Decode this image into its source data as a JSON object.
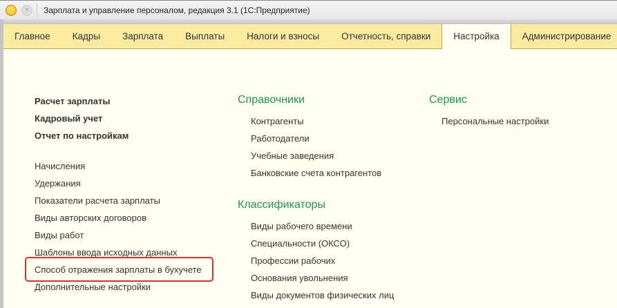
{
  "window": {
    "title": "Зарплата и управление персоналом, редакция 3.1  (1С:Предприятие)",
    "logo_text": "1С"
  },
  "tabs": [
    "Главное",
    "Кадры",
    "Зарплата",
    "Выплаты",
    "Налоги и взносы",
    "Отчетность, справки",
    "Настройка",
    "Администрирование"
  ],
  "active_tab": "Настройка",
  "left": {
    "bold": [
      "Расчет зарплаты",
      "Кадровый учет",
      "Отчет по настройкам"
    ],
    "items": [
      "Начисления",
      "Удержания",
      "Показатели расчета зарплаты",
      "Виды авторских договоров",
      "Виды работ",
      "Шаблоны ввода исходных данных",
      "Способ отражения зарплаты в бухучете",
      "Дополнительные настройки"
    ]
  },
  "middle": {
    "directories_title": "Справочники",
    "directories": [
      "Контрагенты",
      "Работодатели",
      "Учебные заведения",
      "Банковские счета контрагентов"
    ],
    "classifiers_title": "Классификаторы",
    "classifiers": [
      "Виды рабочего времени",
      "Специальности (ОКСО)",
      "Профессии рабочих",
      "Основания увольнения",
      "Виды документов физических лиц"
    ]
  },
  "right": {
    "service_title": "Сервис",
    "service": [
      "Персональные настройки"
    ]
  },
  "colors": {
    "heading": "#1a9a4a",
    "highlight": "#e0302a",
    "tabbar": "#fbeba0"
  }
}
